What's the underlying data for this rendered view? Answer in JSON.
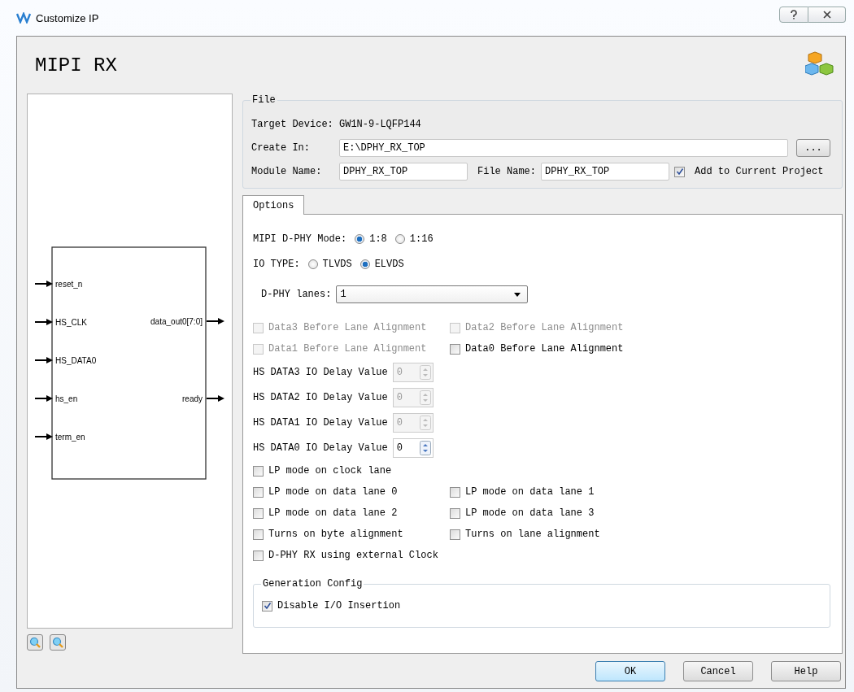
{
  "window": {
    "title": "Customize IP"
  },
  "header": {
    "title": "MIPI RX"
  },
  "diagram": {
    "inputs": [
      "reset_n",
      "HS_CLK",
      "HS_DATA0",
      "hs_en",
      "term_en"
    ],
    "outputs": [
      "data_out0[7:0]",
      "ready"
    ]
  },
  "file": {
    "legend": "File",
    "target_device_label": "Target Device:",
    "target_device": "GW1N-9-LQFP144",
    "create_in_label": "Create In:",
    "create_in": "E:\\DPHY_RX_TOP",
    "browse": "...",
    "module_name_label": "Module Name:",
    "module_name": "DPHY_RX_TOP",
    "file_name_label": "File Name:",
    "file_name": "DPHY_RX_TOP",
    "add_to_project": {
      "label": "Add to Current Project",
      "checked": true
    }
  },
  "tabs": [
    {
      "label": "Options",
      "selected": true
    }
  ],
  "mode": {
    "label": "MIPI D-PHY Mode:",
    "radios": [
      {
        "label": "1:8",
        "selected": true
      },
      {
        "label": "1:16",
        "selected": false
      }
    ]
  },
  "io_type": {
    "label": "IO TYPE:",
    "radios": [
      {
        "label": "TLVDS",
        "selected": false
      },
      {
        "label": "ELVDS",
        "selected": true
      }
    ]
  },
  "lanes": {
    "label": "D-PHY lanes:",
    "value": "1"
  },
  "rows": [
    [
      {
        "kind": "checkbox",
        "label": "Data3 Before Lane Alignment",
        "checked": false,
        "disabled": true
      },
      {
        "kind": "checkbox",
        "label": "Data2 Before Lane Alignment",
        "checked": false,
        "disabled": true
      }
    ],
    [
      {
        "kind": "checkbox",
        "label": "Data1 Before Lane Alignment",
        "checked": false,
        "disabled": true
      },
      {
        "kind": "checkbox",
        "label": "Data0 Before Lane Alignment",
        "checked": false,
        "disabled": false
      }
    ],
    [
      {
        "kind": "spinner",
        "label": "HS DATA3 IO Delay Value",
        "value": "0",
        "disabled": true
      }
    ],
    [
      {
        "kind": "spinner",
        "label": "HS DATA2 IO Delay Value",
        "value": "0",
        "disabled": true
      }
    ],
    [
      {
        "kind": "spinner",
        "label": "HS DATA1 IO Delay Value",
        "value": "0",
        "disabled": true
      }
    ],
    [
      {
        "kind": "spinner",
        "label": "HS DATA0 IO Delay Value",
        "value": "0",
        "disabled": false
      }
    ],
    [
      {
        "kind": "checkbox",
        "label": "LP mode on clock lane",
        "checked": false,
        "disabled": false
      }
    ],
    [
      {
        "kind": "checkbox",
        "label": "LP mode on data lane 0",
        "checked": false,
        "disabled": false
      },
      {
        "kind": "checkbox",
        "label": "LP mode on data lane 1",
        "checked": false,
        "disabled": false
      }
    ],
    [
      {
        "kind": "checkbox",
        "label": "LP mode on data lane 2",
        "checked": false,
        "disabled": false
      },
      {
        "kind": "checkbox",
        "label": "LP mode on data lane 3",
        "checked": false,
        "disabled": false
      }
    ],
    [
      {
        "kind": "checkbox",
        "label": "Turns on byte alignment",
        "checked": false,
        "disabled": false
      },
      {
        "kind": "checkbox",
        "label": "Turns on lane alignment",
        "checked": false,
        "disabled": false
      }
    ],
    [
      {
        "kind": "checkbox",
        "label": "D-PHY RX using external Clock",
        "checked": false,
        "disabled": false
      }
    ]
  ],
  "generation": {
    "legend": "Generation Config",
    "checkbox": {
      "label": "Disable I/O Insertion",
      "checked": true
    }
  },
  "buttons": [
    {
      "label": "OK",
      "default": true
    },
    {
      "label": "Cancel",
      "default": false
    },
    {
      "label": "Help",
      "default": false
    }
  ]
}
